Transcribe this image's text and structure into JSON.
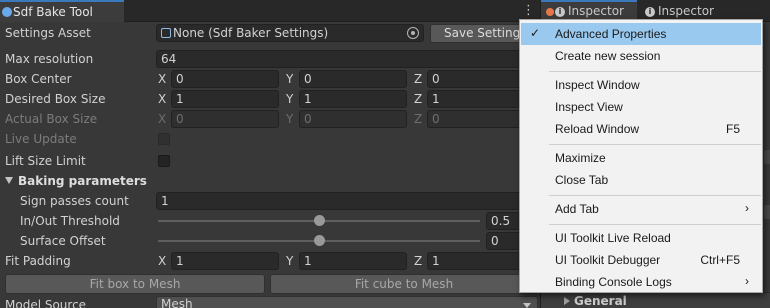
{
  "left_tab": {
    "title": "Sdf Bake Tool",
    "menu_glyph": "⋮"
  },
  "settings_asset": {
    "label": "Settings Asset",
    "value": "None (Sdf Baker Settings)",
    "save_label": "Save Settings"
  },
  "max_resolution": {
    "label": "Max resolution",
    "value": "64"
  },
  "box_center": {
    "label": "Box Center",
    "x": "0",
    "y": "0",
    "z": "0"
  },
  "desired_box_size": {
    "label": "Desired Box Size",
    "x": "1",
    "y": "1",
    "z": "1"
  },
  "actual_box_size": {
    "label": "Actual Box Size",
    "x": "0",
    "y": "0",
    "z": "0"
  },
  "live_update": {
    "label": "Live Update",
    "checked": false
  },
  "lift_size_limit": {
    "label": "Lift Size Limit",
    "checked": false
  },
  "baking_parameters": {
    "label": "Baking parameters",
    "expanded": true
  },
  "sign_passes": {
    "label": "Sign passes count",
    "value": "1"
  },
  "inout_threshold": {
    "label": "In/Out Threshold",
    "value": "0.5",
    "level": 0.5
  },
  "surface_offset": {
    "label": "Surface Offset",
    "value": "0",
    "level": 0.5
  },
  "fit_padding": {
    "label": "Fit Padding",
    "x": "1",
    "y": "1",
    "z": "1"
  },
  "buttons": {
    "fit_box": "Fit box to Mesh",
    "fit_cube": "Fit cube to Mesh"
  },
  "model_source": {
    "label": "Model Source",
    "value": "Mesh"
  },
  "axis_labels": {
    "x": "X",
    "y": "Y",
    "z": "Z"
  },
  "inspector": {
    "tab1": "Inspector",
    "tab2": "Inspector",
    "info_glyph": "i",
    "general_label": "General",
    "colors": {
      "notification_dot": "#e8764b",
      "tab_accent": "#3a79bb"
    }
  },
  "context_menu": {
    "check_glyph": "✓",
    "submenu_glyph": "›",
    "items": [
      {
        "label": "Advanced Properties",
        "checked": true,
        "highlighted": true
      },
      {
        "label": "Create new session"
      },
      {
        "label": "Inspect Window"
      },
      {
        "label": "Inspect View"
      },
      {
        "label": "Reload Window",
        "shortcut": "F5"
      },
      {
        "label": "Maximize"
      },
      {
        "label": "Close Tab"
      },
      {
        "label": "Add Tab",
        "submenu": true
      },
      {
        "label": "UI Toolkit Live Reload"
      },
      {
        "label": "UI Toolkit Debugger",
        "shortcut": "Ctrl+F5"
      },
      {
        "label": "Binding Console Logs",
        "submenu": true
      }
    ],
    "highlight_color": "#99c9ef"
  }
}
